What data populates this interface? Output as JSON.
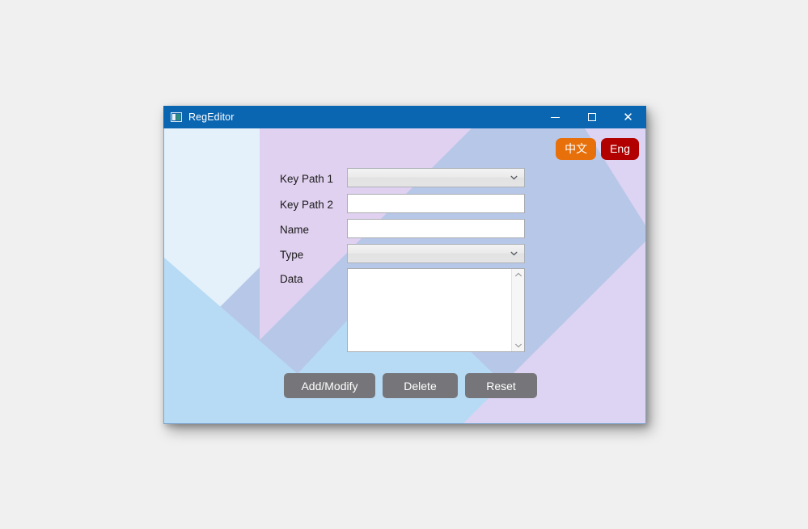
{
  "window": {
    "title": "RegEditor",
    "icon": "app-icon",
    "controls": {
      "minimize": "–",
      "maximize": "□",
      "close": "✕"
    },
    "titlebar_color": "#0b66b2"
  },
  "language": {
    "chinese_label": "中文",
    "chinese_color": "#e8700a",
    "english_label": "Eng",
    "english_color": "#b20000"
  },
  "form": {
    "fields": [
      {
        "label": "Key Path 1",
        "type": "select",
        "value": "",
        "placeholder": ""
      },
      {
        "label": "Key Path 2",
        "type": "text",
        "value": "",
        "placeholder": ""
      },
      {
        "label": "Name",
        "type": "text",
        "value": "",
        "placeholder": ""
      },
      {
        "label": "Type",
        "type": "select",
        "value": "",
        "placeholder": ""
      },
      {
        "label": "Data",
        "type": "textarea",
        "value": "",
        "placeholder": ""
      }
    ]
  },
  "actions": {
    "add_modify": "Add/Modify",
    "delete": "Delete",
    "reset": "Reset",
    "button_color": "#76767a"
  },
  "background": {
    "pale_blue": "#e4f1fb",
    "lavender": "#e0d1f0",
    "periwinkle": "#b7c7e8",
    "sky_blue": "#b7dbf4",
    "light_lavender": "#ddd3f2"
  }
}
